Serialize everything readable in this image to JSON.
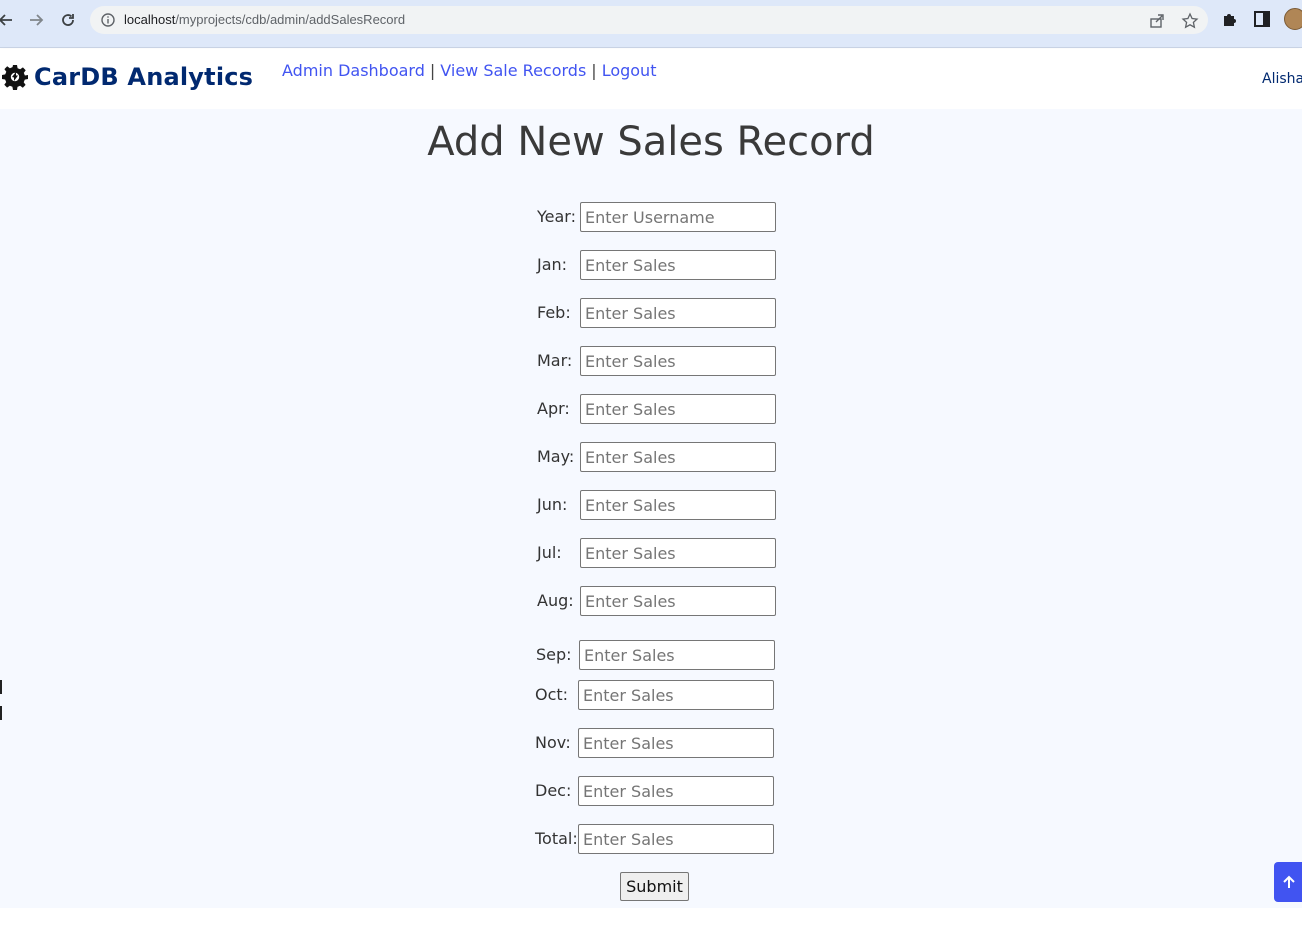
{
  "browser": {
    "url_host": "localhost",
    "url_path": "/myprojects/cdb/admin/addSalesRecord",
    "icons": [
      "back-arrow-icon",
      "forward-arrow-icon",
      "reload-icon",
      "info-icon",
      "share-icon",
      "star-icon",
      "extensions-icon",
      "side-panel-icon",
      "profile-avatar"
    ]
  },
  "header": {
    "brand": "CarDB Analytics",
    "nav": {
      "dashboard": "Admin Dashboard",
      "sep1": "|",
      "records": "View Sale Records",
      "sep2": "|",
      "logout": "Logout"
    },
    "user": "Alisha"
  },
  "main": {
    "title": "Add New Sales Record",
    "fields": [
      {
        "label": "Year:",
        "placeholder": "Enter Username"
      },
      {
        "label": "Jan:",
        "placeholder": "Enter Sales"
      },
      {
        "label": "Feb:",
        "placeholder": "Enter Sales"
      },
      {
        "label": "Mar:",
        "placeholder": "Enter Sales"
      },
      {
        "label": "Apr:",
        "placeholder": "Enter Sales"
      },
      {
        "label": "May:",
        "placeholder": "Enter Sales"
      },
      {
        "label": "Jun:",
        "placeholder": "Enter Sales"
      },
      {
        "label": "Jul:",
        "placeholder": "Enter Sales"
      },
      {
        "label": "Aug:",
        "placeholder": "Enter Sales"
      },
      {
        "label": "Sep:",
        "placeholder": "Enter Sales"
      },
      {
        "label": "Oct:",
        "placeholder": "Enter Sales"
      },
      {
        "label": "Nov:",
        "placeholder": "Enter Sales"
      },
      {
        "label": "Dec:",
        "placeholder": "Enter Sales"
      },
      {
        "label": "Total:",
        "placeholder": "Enter Sales"
      }
    ],
    "submit": "Submit"
  },
  "colors": {
    "brand": "#012970",
    "link": "#4154f1",
    "background": "#f6f9ff",
    "back_to_top": "#4154f1"
  }
}
